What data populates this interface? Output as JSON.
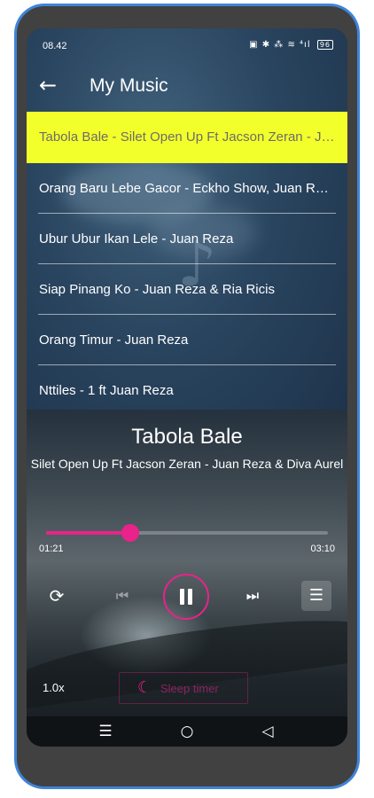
{
  "status_bar": {
    "time": "08.42",
    "icons": "▣ ✱ ⁂ ≋ ⁴ıl",
    "battery": "96"
  },
  "app_bar": {
    "title": "My Music",
    "back_icon": "arrow-left-icon"
  },
  "songs": [
    {
      "label": "Tabola Bale - Silet Open Up Ft Jacson Zeran - Juan Reza & Diva Aurel",
      "active": true
    },
    {
      "label": "Orang Baru Lebe Gacor - Eckho Show, Juan Reza",
      "active": false
    },
    {
      "label": "Ubur Ubur Ikan Lele - Juan Reza",
      "active": false
    },
    {
      "label": "Siap Pinang Ko - Juan Reza & Ria Ricis",
      "active": false
    },
    {
      "label": "Orang Timur - Juan Reza",
      "active": false
    },
    {
      "label": "Nttiles - 1 ft Juan Reza",
      "active": false
    }
  ],
  "player": {
    "title": "Tabola Bale",
    "subtitle": "Silet Open Up Ft Jacson Zeran - Juan Reza & Diva Aurel",
    "current_time": "01:21",
    "total_time": "03:10",
    "progress_fraction": 0.3,
    "speed": "1.0x",
    "sleep_timer_label": "Sleep timer"
  },
  "controls": {
    "repeat_icon": "repeat-icon",
    "previous_icon": "skip-previous-icon",
    "pause_icon": "pause-icon",
    "next_icon": "skip-next-icon",
    "playlist_icon": "playlist-icon"
  },
  "nav_bar": {
    "menu_icon": "recent-apps-icon",
    "home_icon": "home-icon",
    "back_icon": "back-triangle-icon"
  },
  "colors": {
    "accent": "#e8238a",
    "highlight": "#f3ff2a",
    "phone_frame": "#3f84d8"
  }
}
